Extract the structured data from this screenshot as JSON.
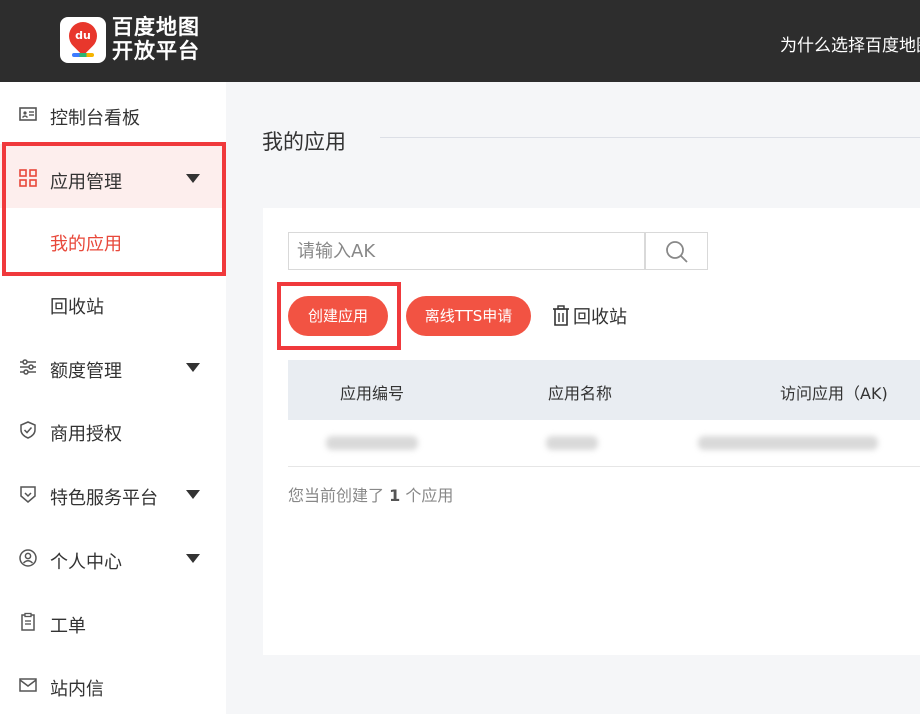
{
  "header": {
    "logo_icon_text": "du",
    "logo_line1": "百度地图",
    "logo_line2": "开放平台",
    "nav_link": "为什么选择百度地图"
  },
  "sidebar": {
    "items": [
      {
        "label": "控制台看板",
        "icon": "dashboard-card-icon"
      },
      {
        "label": "应用管理",
        "icon": "apps-grid-icon"
      },
      {
        "label": "我的应用"
      },
      {
        "label": "回收站"
      },
      {
        "label": "额度管理",
        "icon": "sliders-icon"
      },
      {
        "label": "商用授权",
        "icon": "shield-check-icon"
      },
      {
        "label": "特色服务平台",
        "icon": "heart-badge-icon"
      },
      {
        "label": "个人中心",
        "icon": "user-circle-icon"
      },
      {
        "label": "工单",
        "icon": "clipboard-icon"
      },
      {
        "label": "站内信",
        "icon": "mail-icon"
      }
    ]
  },
  "main": {
    "title": "我的应用",
    "search": {
      "placeholder": "请输入AK"
    },
    "buttons": {
      "create": "创建应用",
      "tts": "离线TTS申请",
      "recycle": "回收站"
    },
    "table": {
      "headers": [
        "应用编号",
        "应用名称",
        "访问应用（AK)"
      ]
    },
    "summary": {
      "prefix": "您当前创建了",
      "count": "1",
      "suffix": "个应用"
    }
  },
  "colors": {
    "accent": "#f25343",
    "highlight_box": "#f0393c",
    "topbar": "#2d2d2d"
  }
}
